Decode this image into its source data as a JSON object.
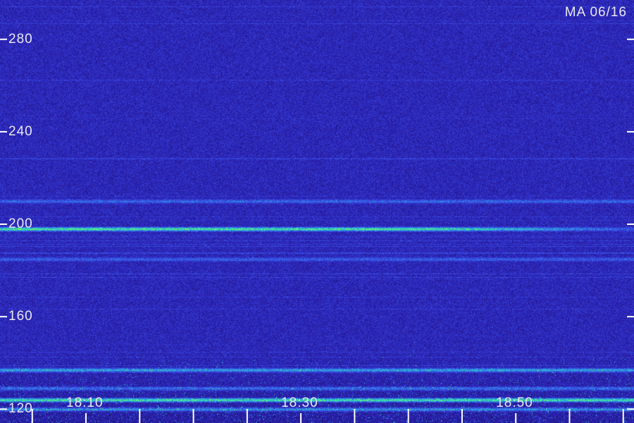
{
  "chart_data": {
    "type": "heatmap",
    "station_label": "MA 06/16",
    "y_ticks": [
      120,
      160,
      200,
      240,
      280
    ],
    "x_ticks": [
      "18:10",
      "18:30",
      "18:50"
    ],
    "ylim": [
      114,
      297
    ],
    "xlim": [
      "18:02",
      "18:61"
    ],
    "background_color": "#241770",
    "colormap": [
      "#1a0f5a",
      "#2a1fb0",
      "#3a4ee8",
      "#2aa8e0",
      "#33e8a0",
      "#9cff3a"
    ],
    "emission_bands": [
      {
        "y": 198,
        "strength": 0.95,
        "note": "strong band fading after 18:35"
      },
      {
        "y": 210,
        "strength": 0.35
      },
      {
        "y": 185,
        "strength": 0.25
      },
      {
        "y": 137,
        "strength": 0.6
      },
      {
        "y": 129,
        "strength": 0.4
      },
      {
        "y": 124,
        "strength": 0.9,
        "note": "bright green line"
      },
      {
        "y": 120,
        "strength": 0.55
      }
    ]
  }
}
